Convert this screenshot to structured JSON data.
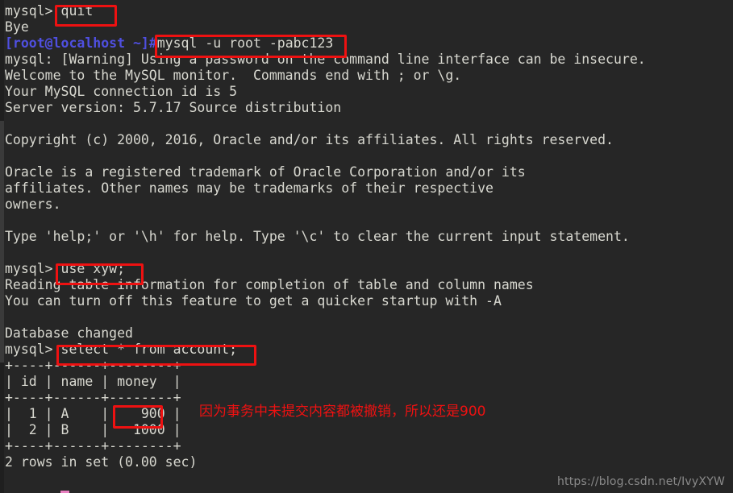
{
  "terminal": {
    "background_color": "#262626",
    "foreground_color": "#d8d8d0",
    "prompt_color": "#4f4fe0",
    "annotation_color": "#ee1111",
    "lines": [
      {
        "id": "l01",
        "text": "mysql> quit"
      },
      {
        "id": "l02",
        "text": "Bye"
      },
      {
        "id": "l03",
        "host_prompt": "[root@localhost ~]#",
        "text": "mysql -u root -pabc123"
      },
      {
        "id": "l04",
        "text": "mysql: [Warning] Using a password on the command line interface can be insecure."
      },
      {
        "id": "l05",
        "text": "Welcome to the MySQL monitor.  Commands end with ; or \\g."
      },
      {
        "id": "l06",
        "text": "Your MySQL connection id is 5"
      },
      {
        "id": "l07",
        "text": "Server version: 5.7.17 Source distribution"
      },
      {
        "id": "l08",
        "text": ""
      },
      {
        "id": "l09",
        "text": "Copyright (c) 2000, 2016, Oracle and/or its affiliates. All rights reserved."
      },
      {
        "id": "l10",
        "text": ""
      },
      {
        "id": "l11",
        "text": "Oracle is a registered trademark of Oracle Corporation and/or its"
      },
      {
        "id": "l12",
        "text": "affiliates. Other names may be trademarks of their respective"
      },
      {
        "id": "l13",
        "text": "owners."
      },
      {
        "id": "l14",
        "text": ""
      },
      {
        "id": "l15",
        "text": "Type 'help;' or '\\h' for help. Type '\\c' to clear the current input statement."
      },
      {
        "id": "l16",
        "text": ""
      },
      {
        "id": "l17",
        "text": "mysql> use xyw;"
      },
      {
        "id": "l18",
        "text": "Reading table information for completion of table and column names"
      },
      {
        "id": "l19",
        "text": "You can turn off this feature to get a quicker startup with -A"
      },
      {
        "id": "l20",
        "text": ""
      },
      {
        "id": "l21",
        "text": "Database changed"
      },
      {
        "id": "l22",
        "text": "mysql> select * from account;"
      },
      {
        "id": "l23",
        "text": "+----+------+--------+"
      },
      {
        "id": "l24",
        "text": "| id | name | money  |"
      },
      {
        "id": "l25",
        "text": "+----+------+--------+"
      },
      {
        "id": "l26",
        "text": "|  1 | A    |    900 |"
      },
      {
        "id": "l27",
        "text": "|  2 | B    |   1000 |"
      },
      {
        "id": "l28",
        "text": "+----+------+--------+"
      },
      {
        "id": "l29",
        "text": "2 rows in set (0.00 sec)"
      },
      {
        "id": "l30",
        "text": ""
      }
    ]
  },
  "query_result": {
    "type": "table",
    "columns": [
      "id",
      "name",
      "money"
    ],
    "rows": [
      [
        "1",
        "A",
        "900"
      ],
      [
        "2",
        "B",
        "1000"
      ]
    ],
    "row_count_text": "2 rows in set (0.00 sec)"
  },
  "highlights": [
    {
      "name": "highlight-quit",
      "label": "quit"
    },
    {
      "name": "highlight-mysql-login",
      "label": "mysql -u root -pabc123"
    },
    {
      "name": "highlight-use-database",
      "label": "use xyw;"
    },
    {
      "name": "highlight-select-account",
      "label": "select * from account;"
    },
    {
      "name": "highlight-money-value",
      "label": "900"
    }
  ],
  "annotation": {
    "text": "因为事务中未提交内容都被撤销，所以还是900"
  },
  "watermark": {
    "text": "https://blog.csdn.net/IvyXYW"
  }
}
